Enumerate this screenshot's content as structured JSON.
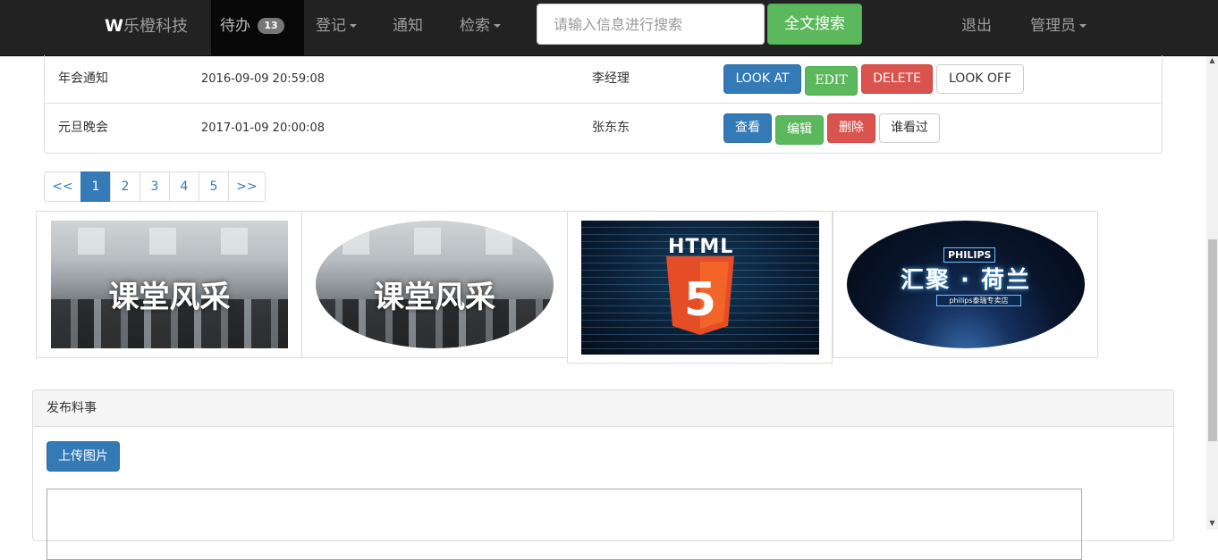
{
  "navbar": {
    "brand_mark": "W",
    "brand_text": "乐橙科技",
    "todo_label": "待办",
    "todo_count": "13",
    "register_label": "登记",
    "notice_label": "通知",
    "search_menu_label": "检索",
    "search_placeholder": "请输入信息进行搜索",
    "search_button": "全文搜索",
    "logout_label": "退出",
    "admin_label": "管理员"
  },
  "table": {
    "rows": [
      {
        "title": "年会通知",
        "date": "2016-09-09 20:59:08",
        "person": "李经理",
        "view": "LOOK AT",
        "edit": "EDIT",
        "delete": "DELETE",
        "viewed": "LOOK OFF"
      },
      {
        "title": "元旦晚会",
        "date": "2017-01-09 20:00:08",
        "person": "张东东",
        "view": "查看",
        "edit": "编辑",
        "delete": "删除",
        "viewed": "谁看过"
      }
    ]
  },
  "pagination": [
    "<<",
    "1",
    "2",
    "3",
    "4",
    "5",
    ">>"
  ],
  "pagination_active": "1",
  "gallery": {
    "img1_text": "课堂风采",
    "img2_text": "课堂风采",
    "img3_text": "HTML",
    "img3_badge": "5",
    "img4_logo": "PHILIPS",
    "img4_main": "汇聚 · 荷兰",
    "img4_sub": "philips泰瑞专卖店"
  },
  "panel": {
    "heading": "发布料事",
    "upload_button": "上传图片"
  },
  "colors": {
    "navbar_bg": "#222222",
    "primary": "#337ab7",
    "success": "#5cb85c",
    "danger": "#d9534f"
  }
}
